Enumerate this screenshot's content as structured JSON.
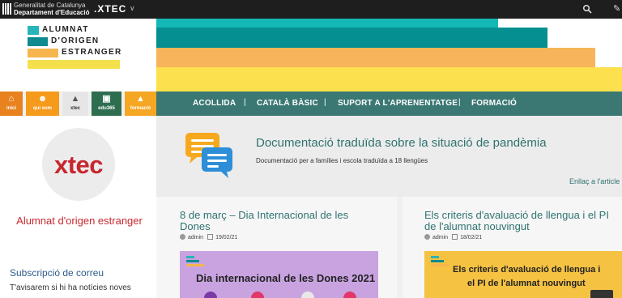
{
  "topbar": {
    "gencat_line1": "Generalitat de Catalunya",
    "gencat_line2": "Departament d'Educació",
    "xtec_label": ".XTEC",
    "chevron": "∨",
    "tool_glyph": "✎",
    "background_color": "#1e1e1e"
  },
  "logo": {
    "words": [
      "ALUMNAT",
      "D'ORIGEN",
      "ESTRANGER"
    ],
    "colors": [
      "#29b4b9",
      "#0f8a8f",
      "#f6b54e",
      "#f4e04d"
    ]
  },
  "stripes": {
    "colors": [
      "#14b8b6",
      "#068f91",
      "#f8b45a",
      "#fce04e"
    ]
  },
  "icon_nav": [
    {
      "label": "inici",
      "icon": "home-icon",
      "glyph": "⌂",
      "color": "#e8821e"
    },
    {
      "label": "qui som",
      "icon": "people-icon",
      "glyph": "☻",
      "color": "#f59a1a"
    },
    {
      "label": "xtec",
      "icon": "graduation-cap-icon",
      "glyph": "▲",
      "color": "#e6e6e6"
    },
    {
      "label": "edu365",
      "icon": "monitor-icon",
      "glyph": "▣",
      "color": "#2e6d4f"
    },
    {
      "label": "formació",
      "icon": "mortarboard-icon",
      "glyph": "▲",
      "color": "#f5a623"
    }
  ],
  "main_nav": {
    "items": [
      "ACOLLIDA",
      "CATALÀ BÀSIC",
      "SUPORT A L'APRENENTATGE",
      "FORMACIÓ"
    ],
    "separator": "|",
    "color": "#3b7874"
  },
  "sidebar": {
    "xtec_logo": "xtec",
    "site_name": "Alumnat d'origen estranger",
    "subscribe_title": "Subscripció de correu",
    "subscribe_text": "T'avisarem si hi ha notícies noves"
  },
  "featured": {
    "title": "Documentació traduïda sobre la situació de pandèmia",
    "text": "Documentació per a famílies i escola traduïda a 18 llengües",
    "link": "Enllaç a l'article"
  },
  "posts": [
    {
      "title": "8 de març – Dia Internacional de les Dones",
      "author": "admin",
      "date": "19/02/21",
      "image_text": "Dia internacional de les Dones 2021",
      "image_bg": "#c8a3e0"
    },
    {
      "title": "Els criteris d'avaluació de llengua i el PI de l'alumnat nouvingut",
      "author": "admin",
      "date": "18/02/21",
      "image_text_1": "Els criteris d'avaluació de llengua i",
      "image_text_2": "el PI de l'alumnat nouvingut",
      "image_bg": "#f5c242"
    }
  ]
}
